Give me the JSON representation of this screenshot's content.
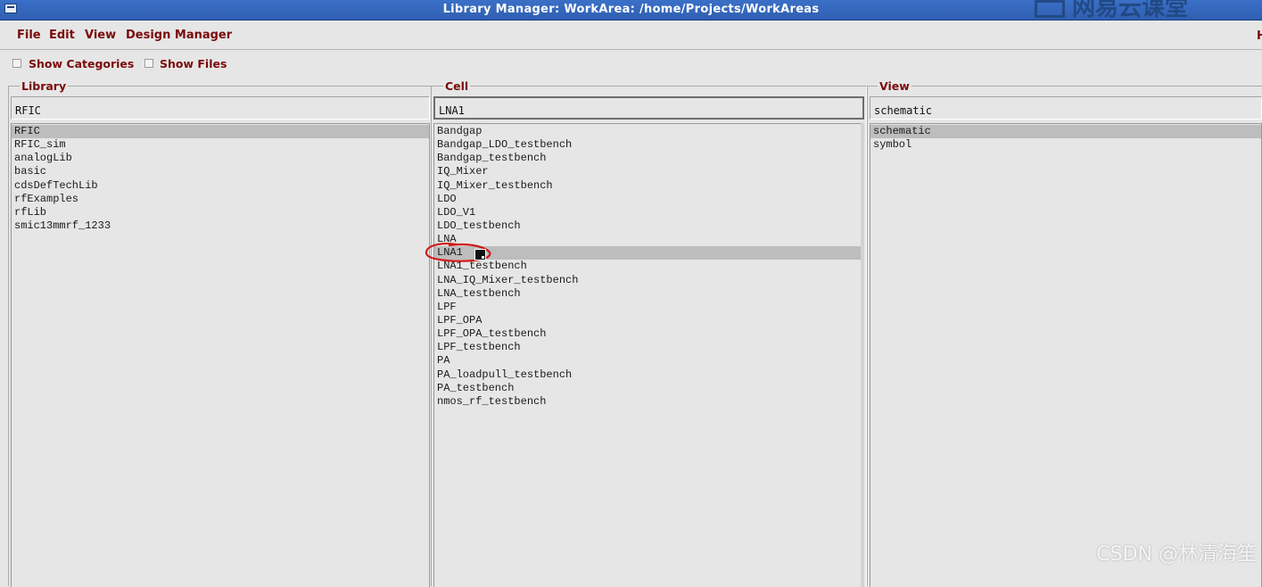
{
  "window": {
    "title": "Library Manager: WorkArea: /home/Projects/WorkAreas",
    "logo_text": "网易云课堂"
  },
  "menu": {
    "items": [
      "File",
      "Edit",
      "View",
      "Design Manager"
    ],
    "help_partial": "H"
  },
  "options": {
    "show_categories": "Show Categories",
    "show_files": "Show Files"
  },
  "library": {
    "label": "Library",
    "value": "RFIC",
    "items": [
      "RFIC",
      "RFIC_sim",
      "analogLib",
      "basic",
      "cdsDefTechLib",
      "rfExamples",
      "rfLib",
      "smic13mmrf_1233"
    ],
    "selected_index": 0
  },
  "cell": {
    "label": "Cell",
    "value": "LNA1",
    "items": [
      "Bandgap",
      "Bandgap_LDO_testbench",
      "Bandgap_testbench",
      "IQ_Mixer",
      "IQ_Mixer_testbench",
      "LDO",
      "LDO_V1",
      "LDO_testbench",
      "LNA",
      "LNA1",
      "LNA1_testbench",
      "LNA_IQ_Mixer_testbench",
      "LNA_testbench",
      "LPF",
      "LPF_OPA",
      "LPF_OPA_testbench",
      "LPF_testbench",
      "PA",
      "PA_loadpull_testbench",
      "PA_testbench",
      "nmos_rf_testbench"
    ],
    "selected_index": 9
  },
  "view": {
    "label": "View",
    "value": "schematic",
    "items": [
      "schematic",
      "symbol"
    ],
    "selected_index": 0
  },
  "watermark": "CSDN @林清海笙",
  "colors": {
    "titlebar": "#2f5fb2",
    "label_text": "#7a0a0a",
    "background": "#e6e6e6",
    "selection": "#bdbdbd",
    "annotation": "#d01818"
  },
  "icons": [
    "window-menu-icon",
    "checkbox-icon",
    "cursor-icon"
  ]
}
